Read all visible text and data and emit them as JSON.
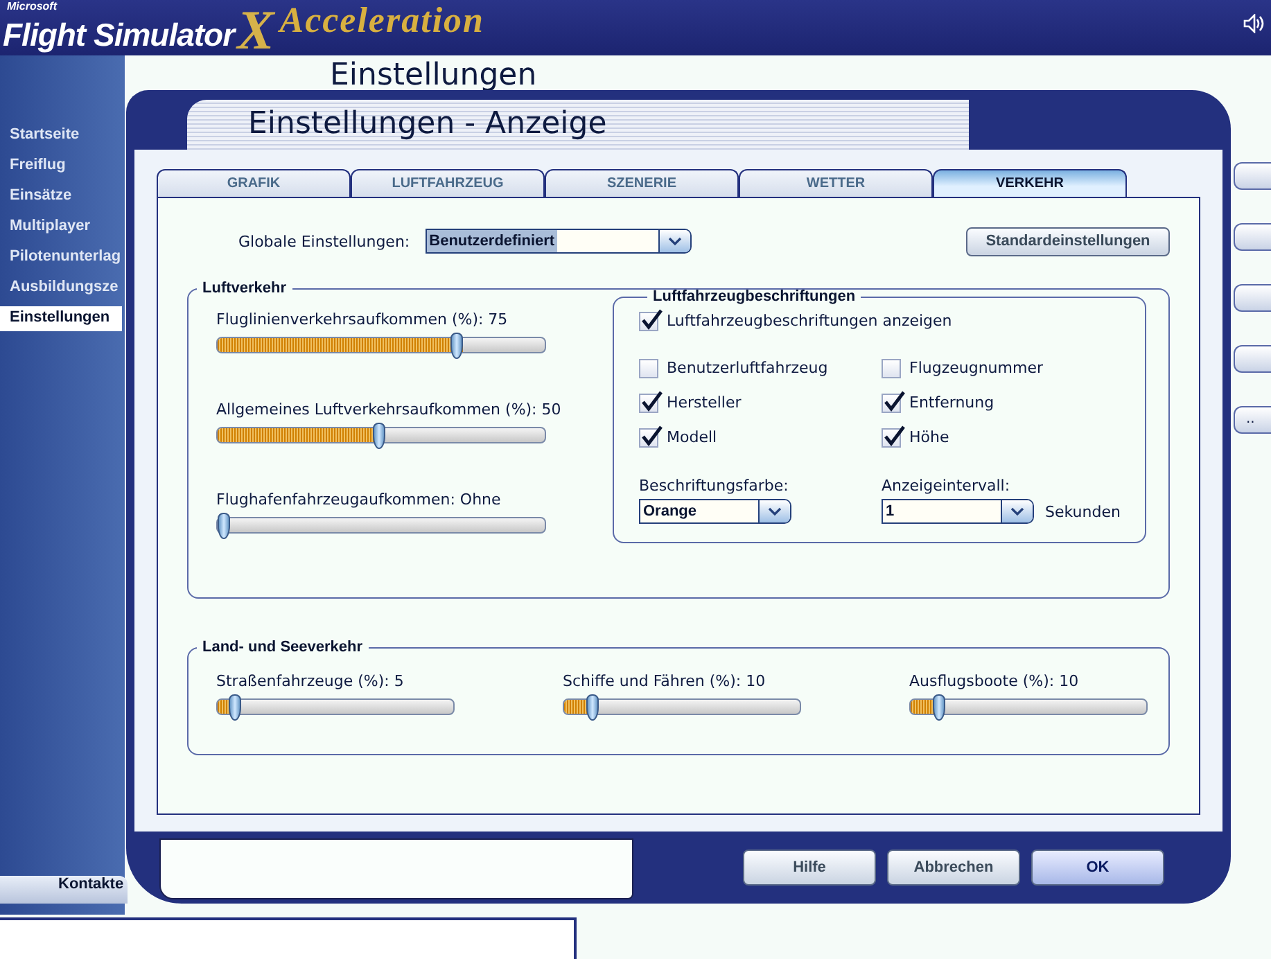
{
  "app": {
    "logo": {
      "brand": "Microsoft",
      "product": "Flight Simulator",
      "mark": "X",
      "edition": "Acceleration"
    },
    "page_title": "Einstellungen"
  },
  "sidebar": {
    "items": [
      {
        "label": "Startseite",
        "selected": false
      },
      {
        "label": "Freiflug",
        "selected": false
      },
      {
        "label": "Einsätze",
        "selected": false
      },
      {
        "label": "Multiplayer",
        "selected": false
      },
      {
        "label": "Pilotenunterlag",
        "selected": false
      },
      {
        "label": "Ausbildungsze",
        "selected": false
      },
      {
        "label": "Einstellungen",
        "selected": true
      }
    ]
  },
  "side_buttons": [
    {
      "kind": "blank"
    },
    {
      "kind": "blank"
    },
    {
      "kind": "blank"
    },
    {
      "kind": "blank"
    },
    {
      "kind": "text",
      "label": ".."
    }
  ],
  "bottom_tab": {
    "label": "Kontakte"
  },
  "dialog": {
    "title": "Einstellungen - Anzeige",
    "tabs": [
      {
        "label": "GRAFIK",
        "selected": false
      },
      {
        "label": "LUFTFAHRZEUG",
        "selected": false
      },
      {
        "label": "SZENERIE",
        "selected": false
      },
      {
        "label": "WETTER",
        "selected": false
      },
      {
        "label": "VERKEHR",
        "selected": true
      }
    ],
    "global": {
      "label": "Globale Einstellungen:",
      "value": "Benutzerdefiniert",
      "text_selected": true
    },
    "reset_button": "Standardeinstellungen",
    "air_traffic": {
      "title": "Luftverkehr",
      "sliders": [
        {
          "label": "Fluglinienverkehrsaufkommen (%): 75",
          "level": 0.75
        },
        {
          "label": "Allgemeines Luftverkehrsaufkommen (%): 50",
          "level": 0.5
        },
        {
          "label": "Flughafenfahrzeugaufkommen: Ohne",
          "level": 0
        }
      ]
    },
    "aircraft_labels": {
      "title": "Luftfahrzeugbeschriftungen",
      "show": {
        "label": "Luftfahrzeugbeschriftungen anzeigen",
        "checked": true
      },
      "options": [
        {
          "label": "Benutzerluftfahrzeug",
          "checked": false
        },
        {
          "label": "Flugzeugnummer",
          "checked": false
        },
        {
          "label": "Hersteller",
          "checked": true
        },
        {
          "label": "Entfernung",
          "checked": true
        },
        {
          "label": "Modell",
          "checked": true
        },
        {
          "label": "Höhe",
          "checked": true
        }
      ],
      "color": {
        "label": "Beschriftungsfarbe:",
        "value": "Orange"
      },
      "interval": {
        "label": "Anzeigeintervall:",
        "value": "1",
        "unit": "Sekunden"
      }
    },
    "land_sea": {
      "title": "Land- und Seeverkehr",
      "sliders": [
        {
          "label": "Straßenfahrzeuge (%): 5",
          "level": 0.05
        },
        {
          "label": "Schiffe und Fähren (%): 10",
          "level": 0.1
        },
        {
          "label": "Ausflugsboote (%): 10",
          "level": 0.1
        }
      ]
    },
    "buttons": [
      {
        "label": "Hilfe",
        "primary": false
      },
      {
        "label": "Abbrechen",
        "primary": false
      },
      {
        "label": "OK",
        "primary": true
      }
    ]
  }
}
